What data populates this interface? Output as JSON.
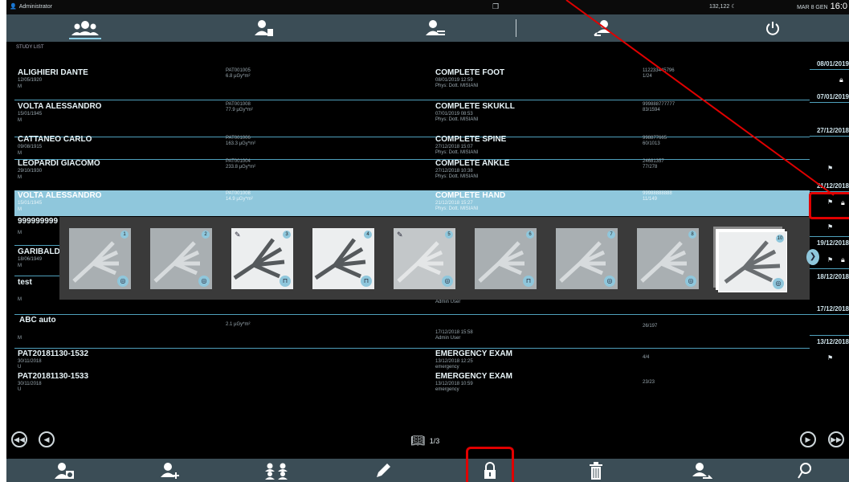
{
  "titlebar": {
    "user": "Administrator",
    "storage": "132,122",
    "date": "MAR 8 GEN",
    "time": "16:0"
  },
  "topnav": {
    "items": [
      "patients-icon",
      "patient-card-icon",
      "patient-list-icon",
      "patient-transfer-icon",
      "power-icon"
    ]
  },
  "study_list_label": "STUDY LIST",
  "rows": [
    {
      "name": "ALIGHIERI DANTE",
      "birth": "12/05/1920",
      "sex": "M",
      "pid": "PAT001005",
      "dose": "6.8 µGy*m²",
      "exam": "COMPLETE FOOT",
      "exam_date": "08/01/2019 12:59",
      "phys": "Phys: Dott. MISIANI",
      "accession": "112233445796",
      "count": "1/24"
    },
    {
      "name": "VOLTA ALESSANDRO",
      "birth": "15/01/1945",
      "sex": "M",
      "pid": "PAT001008",
      "dose": "77.9 µGy*m²",
      "exam": "COMPLETE SKUKLL",
      "exam_date": "07/01/2019 08:53",
      "phys": "Phys: Dott. MISIANI",
      "accession": "999888777777",
      "count": "83/1594"
    },
    {
      "name": "CATTANEO CARLO",
      "birth": "09/08/1915",
      "sex": "M",
      "pid": "PAT001006",
      "dose": "163.3 µGy*m²",
      "exam": "COMPLETE SPINE",
      "exam_date": "27/12/2018 15:07",
      "phys": "Phys: Dott. MISIANI",
      "accession": "998877665",
      "count": "60/1013"
    },
    {
      "name": "LEOPARDI GIACOMO",
      "birth": "29/10/1930",
      "sex": "M",
      "pid": "PAT001004",
      "dose": "233.8 µGy*m²",
      "exam": "COMPLETE ANKLE",
      "exam_date": "27/12/2018 10:38",
      "phys": "Phys: Dott. MISIANI",
      "accession": "24681357",
      "count": "77/278"
    },
    {
      "name": "VOLTA ALESSANDRO",
      "birth": "15/01/1945",
      "sex": "M",
      "pid": "PAT001008",
      "dose": "14.9 µGy*m²",
      "exam": "COMPLETE HAND",
      "exam_date": "21/12/2018 15:27",
      "phys": "Phys: Dott. MISIANI",
      "accession": "99988888888",
      "count": "11/149"
    },
    {
      "name": "999999999",
      "birth": "",
      "sex": "M",
      "pid": "",
      "dose": "",
      "exam": "",
      "exam_date": "",
      "phys": "",
      "accession": "",
      "count": ""
    },
    {
      "name": "GARIBALDI",
      "birth": "18/06/1949",
      "sex": "M",
      "pid": "",
      "dose": "",
      "exam": "",
      "exam_date": "",
      "phys": "",
      "accession": "",
      "count": ""
    },
    {
      "name": "test",
      "birth": "",
      "sex": "M",
      "pid": "",
      "dose": "",
      "exam": "",
      "exam_date": "",
      "phys": "Admin User",
      "accession": "",
      "count": ""
    },
    {
      "name": "ABC auto",
      "birth": "",
      "sex": "M",
      "pid": "",
      "dose": "2.1 µGy*m²",
      "exam": "",
      "exam_date": "17/12/2018 15:58",
      "phys": "Admin User",
      "accession": "",
      "count": "26/197"
    },
    {
      "name": "PAT20181130-1532",
      "birth": "30/11/2018",
      "sex": "U",
      "pid": "",
      "dose": "",
      "exam": "EMERGENCY EXAM",
      "exam_date": "13/12/2018 12:25",
      "phys": "emergency",
      "accession": "",
      "count": "4/4"
    },
    {
      "name": "PAT20181130-1533",
      "birth": "30/11/2018",
      "sex": "U",
      "pid": "",
      "dose": "",
      "exam": "EMERGENCY EXAM",
      "exam_date": "13/12/2018 10:59",
      "phys": "emergency",
      "accession": "",
      "count": "23/23"
    }
  ],
  "dates": [
    "08/01/2019",
    "07/01/2019",
    "27/12/2018",
    "21/12/2018",
    "19/12/2018",
    "18/12/2018",
    "17/12/2018",
    "13/12/2018"
  ],
  "thumbnails": [
    {
      "num": "1",
      "badge": "eye",
      "annot": false,
      "style": "light"
    },
    {
      "num": "2",
      "badge": "eye",
      "annot": false,
      "style": "light"
    },
    {
      "num": "3",
      "badge": "pulse",
      "annot": true,
      "style": "bright"
    },
    {
      "num": "4",
      "badge": "pulse",
      "annot": false,
      "style": "bright"
    },
    {
      "num": "5",
      "badge": "eye",
      "annot": true,
      "style": "light"
    },
    {
      "num": "6",
      "badge": "pulse",
      "annot": false,
      "style": "light"
    },
    {
      "num": "7",
      "badge": "eye",
      "annot": false,
      "style": "light"
    },
    {
      "num": "8",
      "badge": "eye",
      "annot": false,
      "style": "light"
    },
    {
      "num": "10",
      "badge": "eye",
      "annot": false,
      "style": "stack"
    }
  ],
  "pagination": {
    "label": "1/3"
  },
  "bottombar": {
    "items": [
      "patient-radiation-icon",
      "add-patient-icon",
      "merge-patients-icon",
      "edit-icon",
      "lock-icon",
      "delete-icon",
      "send-patient-icon",
      "search-icon"
    ]
  },
  "colors": {
    "accent": "#8fc7dc",
    "bar": "#3b4d56",
    "annotation": "#e00000"
  }
}
